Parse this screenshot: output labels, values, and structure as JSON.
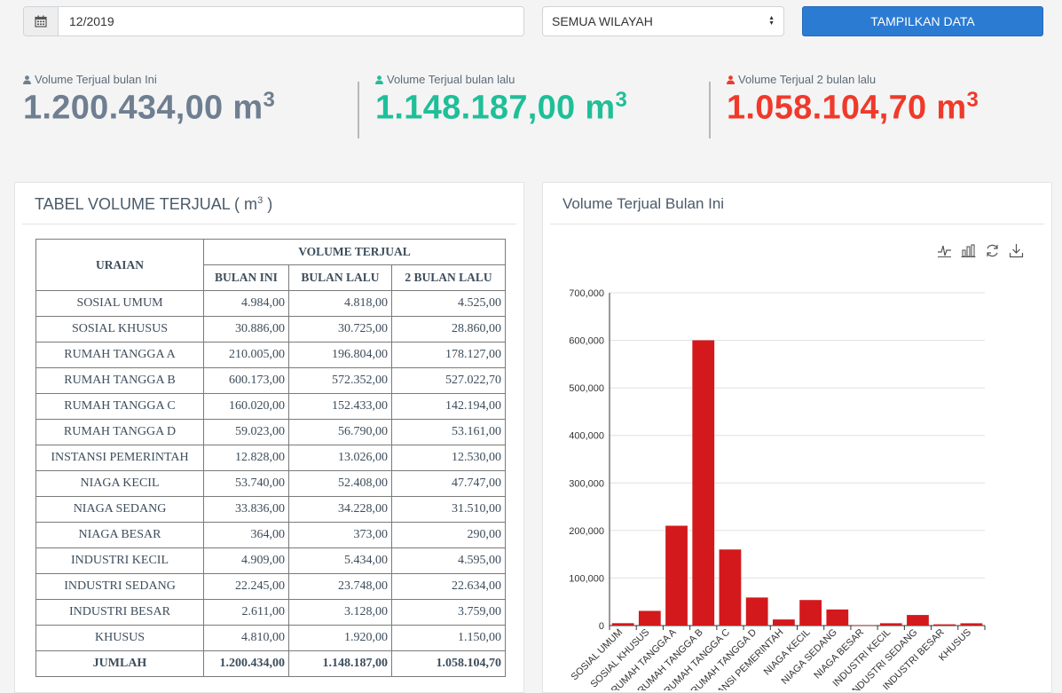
{
  "filters": {
    "date_value": "12/2019",
    "region_selected": "SEMUA WILAYAH",
    "show_button_label": "TAMPILKAN DATA"
  },
  "stats": [
    {
      "label": "Volume Terjual bulan Ini",
      "value": "1.200.434,00 m",
      "unit_sup": "3",
      "color": "#6f7f91"
    },
    {
      "label": "Volume Terjual bulan lalu",
      "value": "1.148.187,00 m",
      "unit_sup": "3",
      "color": "#1fbf98"
    },
    {
      "label": "Volume Terjual 2 bulan lalu",
      "value": "1.058.104,70 m",
      "unit_sup": "3",
      "color": "#ef3a2b"
    }
  ],
  "table_panel": {
    "title": "TABEL VOLUME TERJUAL ( m",
    "title_sup": "3",
    "title_end": " )",
    "headers": {
      "uraian": "URAIAN",
      "group": "VOLUME TERJUAL",
      "cols": [
        "BULAN INI",
        "BULAN LALU",
        "2 BULAN LALU"
      ]
    },
    "rows": [
      [
        "SOSIAL UMUM",
        "4.984,00",
        "4.818,00",
        "4.525,00"
      ],
      [
        "SOSIAL KHUSUS",
        "30.886,00",
        "30.725,00",
        "28.860,00"
      ],
      [
        "RUMAH TANGGA A",
        "210.005,00",
        "196.804,00",
        "178.127,00"
      ],
      [
        "RUMAH TANGGA B",
        "600.173,00",
        "572.352,00",
        "527.022,70"
      ],
      [
        "RUMAH TANGGA C",
        "160.020,00",
        "152.433,00",
        "142.194,00"
      ],
      [
        "RUMAH TANGGA D",
        "59.023,00",
        "56.790,00",
        "53.161,00"
      ],
      [
        "INSTANSI PEMERINTAH",
        "12.828,00",
        "13.026,00",
        "12.530,00"
      ],
      [
        "NIAGA KECIL",
        "53.740,00",
        "52.408,00",
        "47.747,00"
      ],
      [
        "NIAGA SEDANG",
        "33.836,00",
        "34.228,00",
        "31.510,00"
      ],
      [
        "NIAGA BESAR",
        "364,00",
        "373,00",
        "290,00"
      ],
      [
        "INDUSTRI KECIL",
        "4.909,00",
        "5.434,00",
        "4.595,00"
      ],
      [
        "INDUSTRI SEDANG",
        "22.245,00",
        "23.748,00",
        "22.634,00"
      ],
      [
        "INDUSTRI BESAR",
        "2.611,00",
        "3.128,00",
        "3.759,00"
      ],
      [
        "KHUSUS",
        "4.810,00",
        "1.920,00",
        "1.150,00"
      ]
    ],
    "total": [
      "JUMLAH",
      "1.200.434,00",
      "1.148.187,00",
      "1.058.104,70"
    ]
  },
  "chart_panel": {
    "title": "Volume Terjual Bulan Ini",
    "toolbar_icons": [
      "line-chart-icon",
      "bar-chart-icon",
      "refresh-icon",
      "download-icon"
    ]
  },
  "chart_data": {
    "type": "bar",
    "title": "Volume Terjual Bulan Ini",
    "categories": [
      "SOSIAL UMUM",
      "SOSIAL KHUSUS",
      "RUMAH TANGGA A",
      "RUMAH TANGGA B",
      "RUMAH TANGGA C",
      "RUMAH TANGGA D",
      "INSTANSI PEMERINTAH",
      "NIAGA KECIL",
      "NIAGA SEDANG",
      "NIAGA BESAR",
      "INDUSTRI KECIL",
      "INDUSTRI SEDANG",
      "INDUSTRI BESAR",
      "KHUSUS"
    ],
    "values": [
      4984,
      30886,
      210005,
      600173,
      160020,
      59023,
      12828,
      53740,
      33836,
      364,
      4909,
      22245,
      2611,
      4810
    ],
    "ylim": [
      0,
      700000
    ],
    "yticks": [
      "0",
      "100,000",
      "200,000",
      "300,000",
      "400,000",
      "500,000",
      "600,000",
      "700,000"
    ],
    "bar_color": "#d3191c",
    "grid": true
  }
}
